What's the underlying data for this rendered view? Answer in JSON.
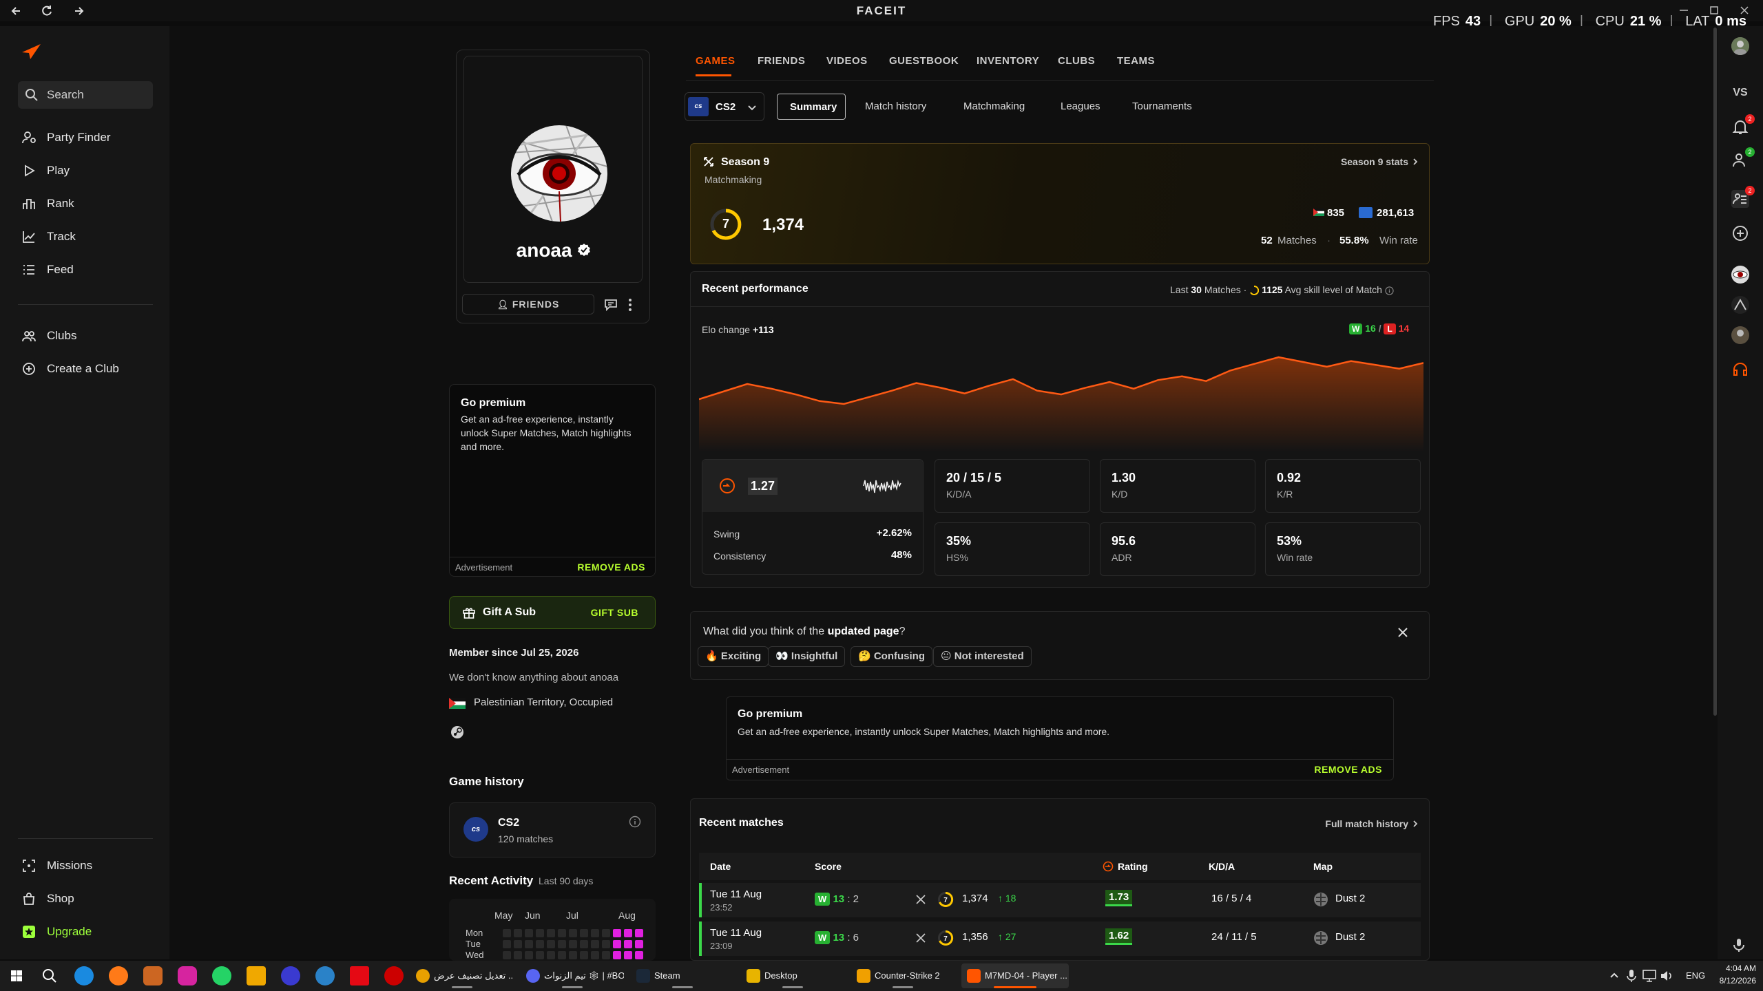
{
  "window": {
    "title": "FACEIT"
  },
  "overlay": {
    "fps_label": "FPS",
    "fps": "43",
    "gpu_label": "GPU",
    "gpu": "20 %",
    "cpu_label": "CPU",
    "cpu": "21 %",
    "lat_label": "LAT",
    "lat": "0 ms"
  },
  "sidebar": {
    "search": "Search",
    "items": [
      "Party Finder",
      "Play",
      "Rank",
      "Track",
      "Feed"
    ],
    "club_items": [
      "Clubs",
      "Create a Club"
    ],
    "bottom": [
      "Missions",
      "Shop",
      "Upgrade"
    ]
  },
  "profile": {
    "username": "anoaa",
    "friends_label": "FRIENDS"
  },
  "premium_left": {
    "title": "Go premium",
    "text": "Get an ad-free experience, instantly unlock Super Matches, Match highlights and more.",
    "ad_label": "Advertisement",
    "remove": "REMOVE ADS"
  },
  "gift": {
    "label": "Gift A Sub",
    "action": "GIFT SUB"
  },
  "about": {
    "member_since": "Member since Jul 25, 2026",
    "bio": "We don't know anything about anoaa",
    "country": "Palestinian Territory, Occupied"
  },
  "game_history": {
    "title": "Game history",
    "game": "CS2",
    "matches": "120 matches"
  },
  "activity": {
    "title": "Recent Activity",
    "range": "Last 90 days",
    "months": [
      "May",
      "Jun",
      "Jul",
      "Aug"
    ],
    "days": [
      "Mon",
      "Tue",
      "Wed"
    ]
  },
  "tabs": [
    "GAMES",
    "FRIENDS",
    "VIDEOS",
    "GUESTBOOK",
    "INVENTORY",
    "CLUBS",
    "TEAMS"
  ],
  "game_select": {
    "value": "CS2"
  },
  "subtabs": [
    "Summary",
    "Match history",
    "Matchmaking",
    "Leagues",
    "Tournaments"
  ],
  "season": {
    "title": "Season 9",
    "subtitle": "Matchmaking",
    "link": "Season 9 stats",
    "level": "7",
    "elo": "1,374",
    "rank_country": "835",
    "rank_region": "281,613",
    "matches_count": "52",
    "matches_label": "Matches",
    "winrate": "55.8%",
    "winrate_label": "Win rate"
  },
  "perf": {
    "title": "Recent performance",
    "last_pre": "Last",
    "last_n": "30",
    "last_post": "Matches ·",
    "avg_elo": "1125",
    "avg_label": "Avg skill level of Match",
    "elo_change_label": "Elo change",
    "elo_change": "+113",
    "wins": "16",
    "losses": "14",
    "rating": "1.27",
    "swing_label": "Swing",
    "swing": "+2.62%",
    "consistency_label": "Consistency",
    "consistency": "48%",
    "stats": [
      {
        "v": "20 / 15 / 5",
        "l": "K/D/A"
      },
      {
        "v": "1.30",
        "l": "K/D"
      },
      {
        "v": "0.92",
        "l": "K/R"
      },
      {
        "v": "35%",
        "l": "HS%"
      },
      {
        "v": "95.6",
        "l": "ADR"
      },
      {
        "v": "53%",
        "l": "Win rate"
      }
    ]
  },
  "elo_series": [
    1336,
    1344,
    1352,
    1347,
    1341,
    1334,
    1331,
    1338,
    1345,
    1353,
    1348,
    1342,
    1350,
    1357,
    1345,
    1341,
    1348,
    1354,
    1347,
    1356,
    1360,
    1355,
    1366,
    1373,
    1380,
    1375,
    1370,
    1376,
    1372,
    1368,
    1374
  ],
  "feedback": {
    "q_pre": "What did you think of the",
    "q_bold": "updated page",
    "q_post": "?",
    "options": [
      "🔥 Exciting",
      "👀 Insightful",
      "🤔 Confusing",
      "😐 Not interested"
    ]
  },
  "premium_mid": {
    "title": "Go premium",
    "text": "Get an ad-free experience, instantly unlock Super Matches, Match highlights and more.",
    "ad_label": "Advertisement",
    "remove": "REMOVE ADS"
  },
  "recent_matches": {
    "title": "Recent matches",
    "link": "Full match history",
    "headers": [
      "Date",
      "Score",
      "Rating",
      "K/D/A",
      "Map"
    ],
    "rows": [
      {
        "date": "Tue 11 Aug",
        "time": "23:52",
        "score_w": "13",
        "score_l": "2",
        "elo": "1,374",
        "delta": "18",
        "rating": "1.73",
        "kda": "16 / 5 / 4",
        "map": "Dust 2"
      },
      {
        "date": "Tue 11 Aug",
        "time": "23:09",
        "score_w": "13",
        "score_l": "6",
        "elo": "1,356",
        "delta": "27",
        "rating": "1.62",
        "kda": "24 / 11 / 5",
        "map": "Dust 2"
      }
    ]
  },
  "taskbar": {
    "apps": [
      "تعديل تصنيف عرض ...",
      "تيم الزنوات 🕸 | #BO...",
      "Steam",
      "Desktop",
      "Counter-Strike 2",
      "M7MD-04 - Player ..."
    ],
    "lang": "ENG",
    "time": "4:04 AM",
    "date": "8/12/2026"
  },
  "colors": {
    "accent": "#ff5500",
    "win": "#3bd84a",
    "loss": "#ff2a2a",
    "upgrade": "#9dff3b"
  }
}
